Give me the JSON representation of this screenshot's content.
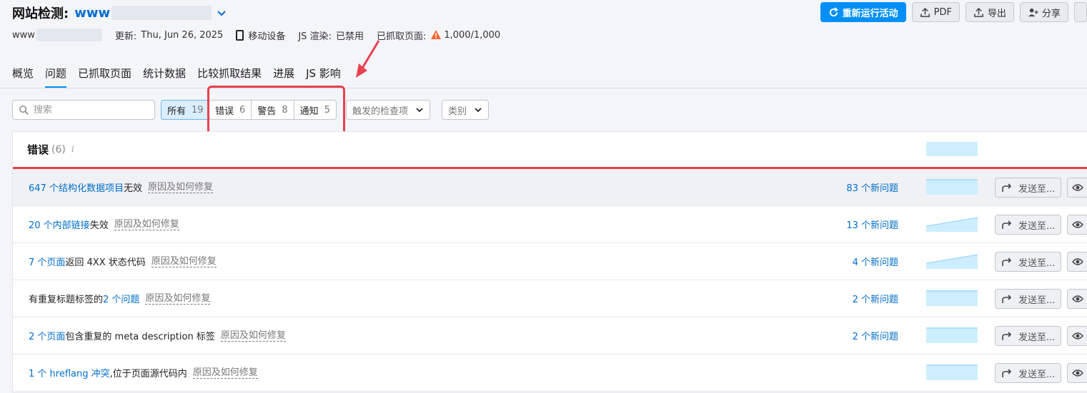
{
  "header": {
    "title": "网站检测:",
    "domain": "www",
    "meta": {
      "site_prefix": "www",
      "updated_label": "更新:",
      "updated_value": "Thu, Jun 26, 2025",
      "device": "移动设备",
      "js_label": "JS 渲染:",
      "js_value": "已禁用",
      "crawled_label": "已抓取页面:",
      "crawled_value": "1,000/1,000"
    },
    "buttons": {
      "rerun": "重新运行活动",
      "pdf": "PDF",
      "export": "导出",
      "share": "分享"
    }
  },
  "tabs": [
    "概览",
    "问题",
    "已抓取页面",
    "统计数据",
    "比较抓取结果",
    "进展",
    "JS 影响"
  ],
  "active_tab": 1,
  "filters": {
    "search_placeholder": "搜索",
    "all": {
      "label": "所有",
      "count": "19"
    },
    "errors": {
      "label": "错误",
      "count": "6"
    },
    "warnings": {
      "label": "警告",
      "count": "8"
    },
    "notices": {
      "label": "通知",
      "count": "5"
    },
    "triggered": "触发的检查项",
    "category": "类别"
  },
  "panel": {
    "title": "错误",
    "count": "(6)",
    "info": "i",
    "fix_label": "原因及如何修复",
    "send_label": "发送至...",
    "rows": [
      {
        "link": "647 个结构化数据项目",
        "text": "无效",
        "new": "83 个新问题",
        "spark": "flat"
      },
      {
        "link": "20 个内部链接",
        "text": "失效",
        "new": "13 个新问题",
        "spark": "rise"
      },
      {
        "link": "7 个页面",
        "text": "返回 4XX 状态代码",
        "new": "4 个新问题",
        "spark": "rise"
      },
      {
        "pre": "有重复标题标签的",
        "link": "2 个问题",
        "text": "",
        "new": "2 个新问题",
        "spark": "flat"
      },
      {
        "link": "2 个页面",
        "text": "包含重复的 meta description 标签",
        "new": "2 个新问题",
        "spark": "flat"
      },
      {
        "link": "1 个 hreflang 冲突",
        "text": ",位于页面源代码内",
        "new": "",
        "spark": "flat"
      }
    ]
  },
  "colors": {
    "accent": "#008ff8",
    "link": "#006dca",
    "error": "#e8414f",
    "spark": "#cdeefe"
  }
}
